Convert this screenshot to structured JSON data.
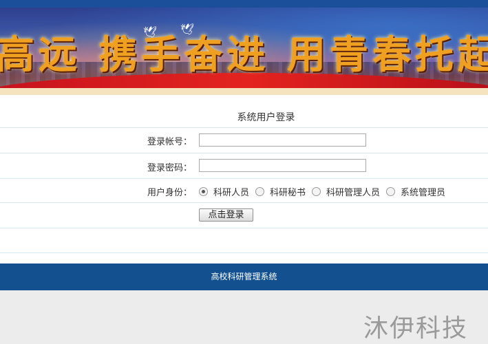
{
  "banner": {
    "slogan": "高远 携手奋进 用青春托起中国"
  },
  "login": {
    "title": "系统用户登录",
    "account_label": "登录帐号：",
    "account_value": "",
    "password_label": "登录密码：",
    "password_value": "",
    "role_label": "用户身份：",
    "roles": [
      {
        "label": "科研人员",
        "checked": true
      },
      {
        "label": "科研秘书",
        "checked": false
      },
      {
        "label": "科研管理人员",
        "checked": false
      },
      {
        "label": "系统管理员",
        "checked": false
      }
    ],
    "submit_label": "点击登录"
  },
  "footer": {
    "text": "高校科研管理系统"
  },
  "watermark": {
    "text": "沐伊科技"
  },
  "colors": {
    "header": "#1b4f9a",
    "footer": "#12508f",
    "row_border": "#d9e8f5",
    "page_bg": "#ececec"
  }
}
